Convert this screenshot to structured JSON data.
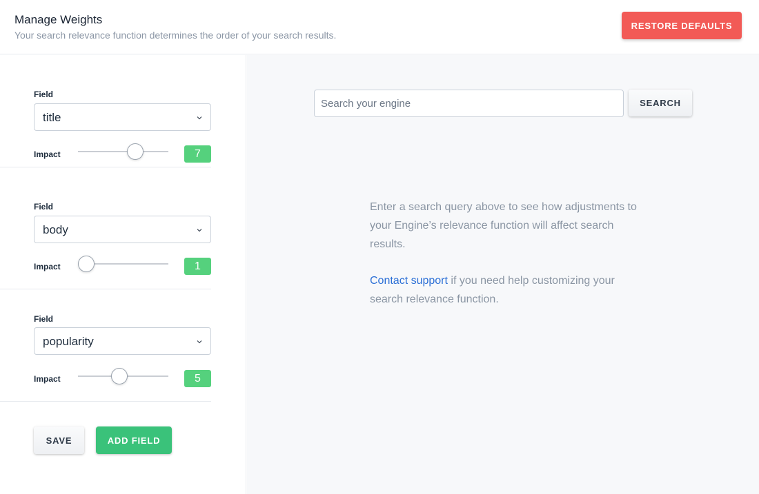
{
  "header": {
    "title": "Manage Weights",
    "subtitle": "Your search relevance function determines the order of your search results.",
    "restore_label": "RESTORE DEFAULTS"
  },
  "fields": [
    {
      "field_label": "Field",
      "value": "title",
      "impact_label": "Impact",
      "impact": 7
    },
    {
      "field_label": "Field",
      "value": "body",
      "impact_label": "Impact",
      "impact": 1
    },
    {
      "field_label": "Field",
      "value": "popularity",
      "impact_label": "Impact",
      "impact": 5
    }
  ],
  "slider_range": {
    "min": 1,
    "max": 10
  },
  "actions": {
    "save_label": "SAVE",
    "add_label": "ADD FIELD"
  },
  "search": {
    "placeholder": "Search your engine",
    "button_label": "SEARCH"
  },
  "info": {
    "paragraph1": "Enter a search query above to see how adjustments to your Engine’s relevance function will affect search results.",
    "link_text": "Contact support",
    "paragraph2_rest": " if you need help customizing your search relevance function."
  },
  "colors": {
    "restore_button": "#f25a56",
    "impact_badge": "#55d17d",
    "add_button": "#3ac27a",
    "link": "#2b6fd6"
  },
  "icons": {
    "select_arrow": "chevron-down-icon"
  }
}
